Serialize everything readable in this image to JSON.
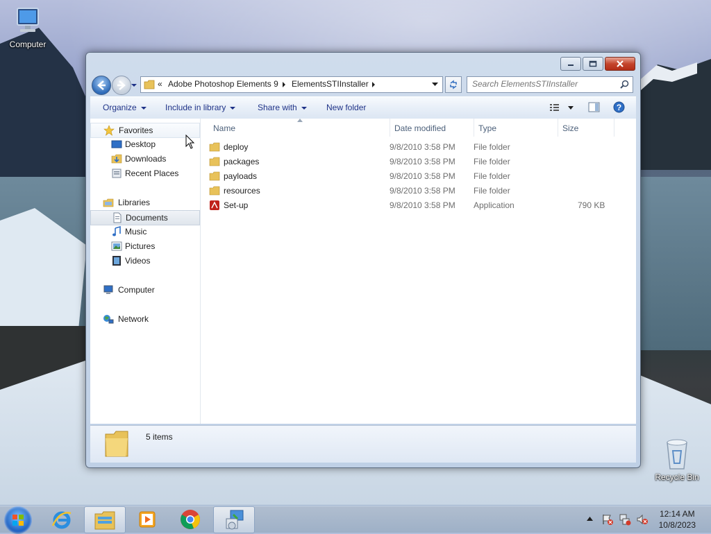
{
  "desktop": {
    "icons": [
      {
        "label": "Computer",
        "icon": "computer-icon"
      },
      {
        "label": "Recycle Bin",
        "icon": "recycle-bin-icon"
      }
    ]
  },
  "window": {
    "caption_buttons": [
      "minimize",
      "maximize",
      "close"
    ],
    "address": {
      "overflow": "«",
      "crumbs": [
        "Adobe Photoshop Elements 9",
        "ElementsSTIInstaller"
      ]
    },
    "search_placeholder": "Search ElementsSTIInstaller",
    "toolbar": {
      "organize": "Organize",
      "include_in_library": "Include in library",
      "share_with": "Share with",
      "new_folder": "New folder"
    },
    "nav_pane": {
      "favorites": "Favorites",
      "favorites_items": [
        "Desktop",
        "Downloads",
        "Recent Places"
      ],
      "libraries": "Libraries",
      "libraries_items": [
        "Documents",
        "Music",
        "Pictures",
        "Videos"
      ],
      "computer": "Computer",
      "network": "Network",
      "selected": "Documents"
    },
    "columns": [
      "Name",
      "Date modified",
      "Type",
      "Size"
    ],
    "files": [
      {
        "name": "deploy",
        "date": "9/8/2010 3:58 PM",
        "type": "File folder",
        "size": "",
        "icon": "folder-icon"
      },
      {
        "name": "packages",
        "date": "9/8/2010 3:58 PM",
        "type": "File folder",
        "size": "",
        "icon": "folder-icon"
      },
      {
        "name": "payloads",
        "date": "9/8/2010 3:58 PM",
        "type": "File folder",
        "size": "",
        "icon": "folder-icon"
      },
      {
        "name": "resources",
        "date": "9/8/2010 3:58 PM",
        "type": "File folder",
        "size": "",
        "icon": "folder-icon"
      },
      {
        "name": "Set-up",
        "date": "9/8/2010 3:58 PM",
        "type": "Application",
        "size": "790 KB",
        "icon": "adobe-app-icon"
      }
    ],
    "details": {
      "item_count": "5 items"
    }
  },
  "taskbar": {
    "pinned": [
      "start-orb",
      "internet-explorer",
      "windows-explorer",
      "media-player",
      "chrome",
      "setup-program"
    ],
    "clock": {
      "time": "12:14 AM",
      "date": "10/8/2023"
    }
  },
  "colors": {
    "link_blue": "#1e3287",
    "folder_yellow": "#e8c25a",
    "close_red": "#c4452c"
  }
}
